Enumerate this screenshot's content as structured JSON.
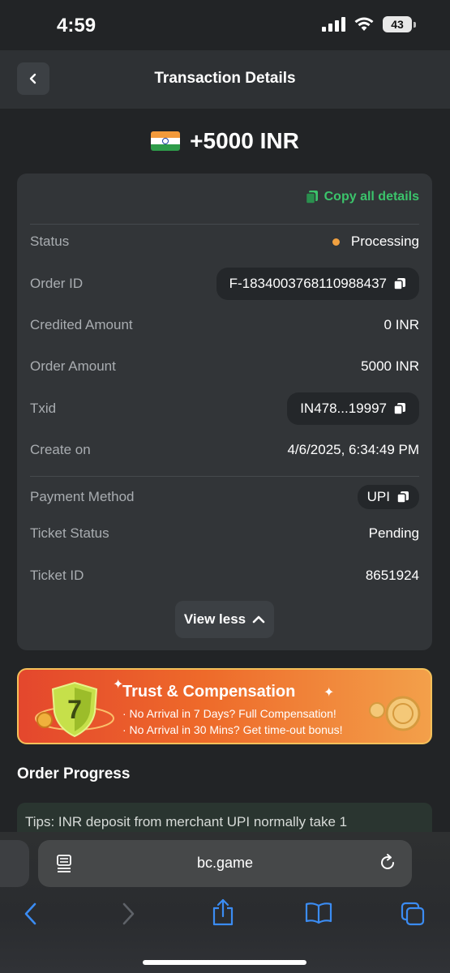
{
  "status_bar": {
    "time": "4:59",
    "battery": "43"
  },
  "header": {
    "title": "Transaction Details"
  },
  "amount": {
    "text": "+5000 INR"
  },
  "details": {
    "copy_all_label": "Copy all details",
    "status_label": "Status",
    "status_value": "Processing",
    "order_id_label": "Order ID",
    "order_id_value": "F-1834003768110988437",
    "credited_amount_label": "Credited Amount",
    "credited_amount_value": "0 INR",
    "order_amount_label": "Order Amount",
    "order_amount_value": "5000 INR",
    "txid_label": "Txid",
    "txid_value": "IN478...19997",
    "create_on_label": "Create on",
    "create_on_value": "4/6/2025, 6:34:49 PM",
    "payment_method_label": "Payment Method",
    "payment_method_value": "UPI",
    "ticket_status_label": "Ticket Status",
    "ticket_status_value": "Pending",
    "ticket_id_label": "Ticket ID",
    "ticket_id_value": "8651924",
    "view_less_label": "View less"
  },
  "banner": {
    "title": "Trust & Compensation",
    "line1": "· No Arrival in 7 Days? Full Compensation!",
    "line2": "· No Arrival in 30 Mins? Get time-out bonus!",
    "shield_number": "7"
  },
  "progress": {
    "title": "Order Progress",
    "tips": "Tips: INR deposit from merchant UPI normally take 1"
  },
  "browser": {
    "url": "bc.game"
  },
  "colors": {
    "accent_green": "#3bc46b",
    "status_orange": "#f0a040",
    "background": "#222426",
    "card": "#323538"
  }
}
